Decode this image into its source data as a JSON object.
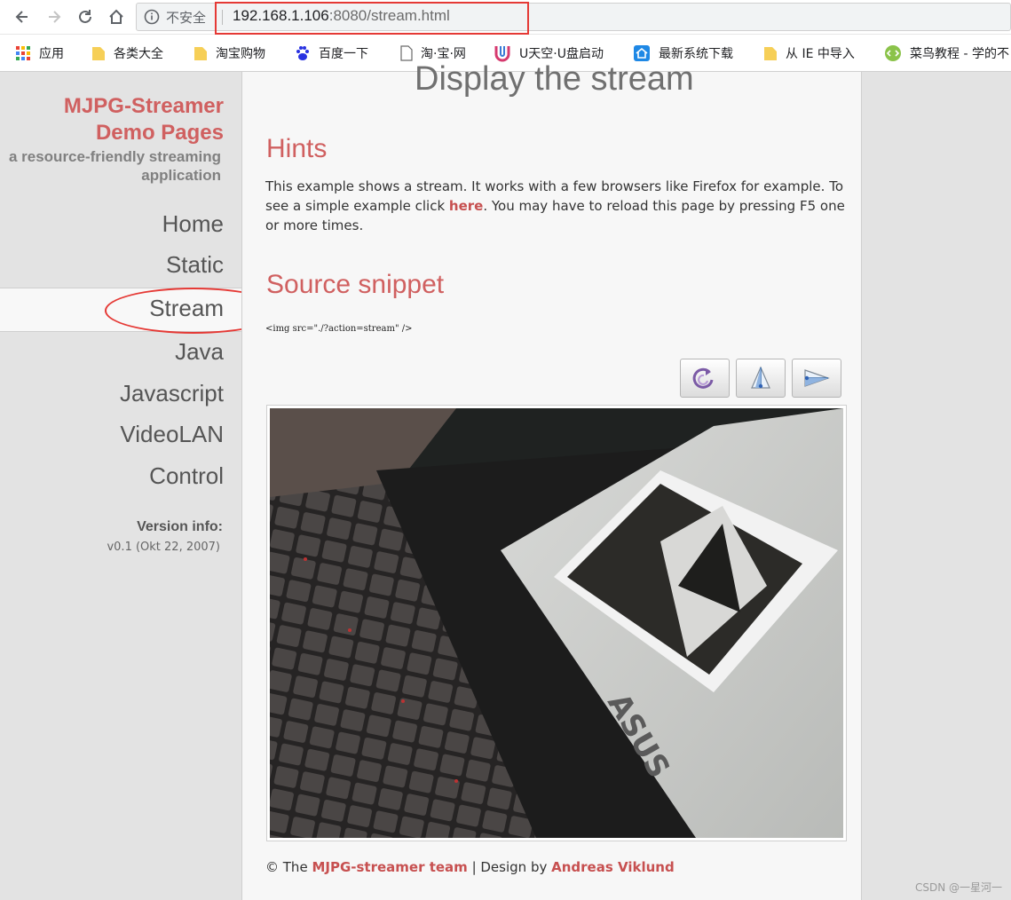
{
  "browser": {
    "insecure_label": "不安全",
    "url_host": "192.168.1.106",
    "url_rest": ":8080/stream.html",
    "bookmarks": [
      {
        "label": "应用",
        "icon": "apps-grid-icon"
      },
      {
        "label": "各类大全",
        "icon": "folder-icon"
      },
      {
        "label": "淘宝购物",
        "icon": "folder-icon"
      },
      {
        "label": "百度一下",
        "icon": "baidu-paw-icon"
      },
      {
        "label": "淘·宝·网",
        "icon": "page-icon"
      },
      {
        "label": "U天空·U盘启动",
        "icon": "u-logo-icon"
      },
      {
        "label": "最新系统下载",
        "icon": "house-icon"
      },
      {
        "label": "从 IE 中导入",
        "icon": "folder-icon"
      },
      {
        "label": "菜鸟教程 - 学的不",
        "icon": "runoob-icon"
      }
    ]
  },
  "sidebar": {
    "title_line1": "MJPG-Streamer",
    "title_line2": "Demo Pages",
    "subtitle_line1": "a resource-friendly streaming",
    "subtitle_line2": "application",
    "menu": [
      "Home",
      "Static",
      "Stream",
      "Java",
      "Javascript",
      "VideoLAN",
      "Control"
    ],
    "active": "Stream",
    "version_title": "Version info:",
    "version_value": "v0.1 (Okt 22, 2007)"
  },
  "content": {
    "heading": "Display the stream",
    "hints_title": "Hints",
    "hints_text_before": "This example shows a stream. It works with a few browsers like Firefox for example. To see a simple example click ",
    "hints_link": "here",
    "hints_text_after": ". You may have to reload this page by pressing F5 one or more times.",
    "snippet_title": "Source snippet",
    "snippet_code": "<img src=\"./?action=stream\" />",
    "control_buttons": [
      "rotate-icon",
      "flip-vertical-icon",
      "flip-horizontal-icon"
    ],
    "footer_prefix": "© The ",
    "footer_link1": "MJPG-streamer team",
    "footer_mid": " | Design by ",
    "footer_link2": "Andreas Viklund"
  },
  "watermark": "CSDN @一星河一",
  "colors": {
    "accent": "#d06060",
    "annotation": "#e53935"
  }
}
